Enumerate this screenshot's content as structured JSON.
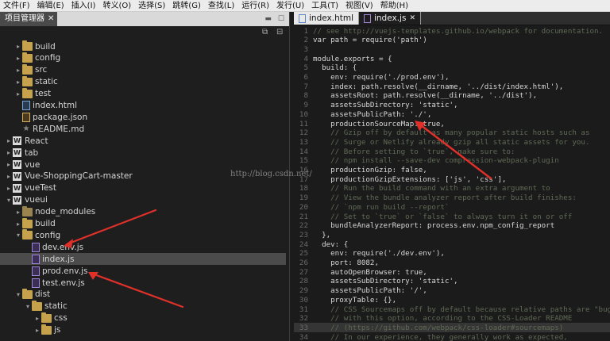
{
  "menu": [
    "文件(F)",
    "编辑(E)",
    "插入(I)",
    "转义(O)",
    "选择(S)",
    "跳转(G)",
    "查找(L)",
    "运行(R)",
    "发行(U)",
    "工具(T)",
    "视图(V)",
    "帮助(H)"
  ],
  "panel": {
    "title": "项目管理器",
    "tree": [
      {
        "label": "build",
        "icon": "folder",
        "depth": 2,
        "arrow": "collapsed"
      },
      {
        "label": "config",
        "icon": "folder",
        "depth": 2,
        "arrow": "collapsed"
      },
      {
        "label": "src",
        "icon": "folder",
        "depth": 2,
        "arrow": "collapsed"
      },
      {
        "label": "static",
        "icon": "folder",
        "depth": 2,
        "arrow": "collapsed"
      },
      {
        "label": "test",
        "icon": "folder",
        "depth": 2,
        "arrow": "collapsed"
      },
      {
        "label": "index.html",
        "icon": "html",
        "depth": 2,
        "arrow": "none"
      },
      {
        "label": "package.json",
        "icon": "json",
        "depth": 2,
        "arrow": "none"
      },
      {
        "label": "README.md",
        "icon": "md",
        "depth": 2,
        "arrow": "none"
      },
      {
        "label": "React",
        "icon": "project",
        "depth": 1,
        "arrow": "collapsed"
      },
      {
        "label": "tab",
        "icon": "project",
        "depth": 1,
        "arrow": "collapsed"
      },
      {
        "label": "vue",
        "icon": "project",
        "depth": 1,
        "arrow": "collapsed"
      },
      {
        "label": "Vue-ShoppingCart-master",
        "icon": "project",
        "depth": 1,
        "arrow": "collapsed"
      },
      {
        "label": "vueTest",
        "icon": "project",
        "depth": 1,
        "arrow": "collapsed"
      },
      {
        "label": "vueui",
        "icon": "project",
        "depth": 1,
        "arrow": "expanded"
      },
      {
        "label": "node_modules",
        "icon": "folder-dark",
        "depth": 2,
        "arrow": "collapsed"
      },
      {
        "label": "build",
        "icon": "folder",
        "depth": 2,
        "arrow": "collapsed"
      },
      {
        "label": "config",
        "icon": "folder",
        "depth": 2,
        "arrow": "expanded"
      },
      {
        "label": "dev.env.js",
        "icon": "js",
        "depth": 3,
        "arrow": "none"
      },
      {
        "label": "index.js",
        "icon": "js",
        "depth": 3,
        "arrow": "none",
        "selected": true
      },
      {
        "label": "prod.env.js",
        "icon": "js",
        "depth": 3,
        "arrow": "none"
      },
      {
        "label": "test.env.js",
        "icon": "js",
        "depth": 3,
        "arrow": "none"
      },
      {
        "label": "dist",
        "icon": "folder",
        "depth": 2,
        "arrow": "expanded"
      },
      {
        "label": "static",
        "icon": "folder",
        "depth": 3,
        "arrow": "expanded"
      },
      {
        "label": "css",
        "icon": "folder",
        "depth": 4,
        "arrow": "collapsed"
      },
      {
        "label": "js",
        "icon": "folder",
        "depth": 4,
        "arrow": "collapsed"
      }
    ]
  },
  "editor": {
    "tabs": [
      {
        "label": "index.html",
        "icon": "html-file-icon",
        "active": false
      },
      {
        "label": "index.js",
        "icon": "js-file-icon",
        "active": true
      }
    ],
    "lines": [
      {
        "n": "1",
        "t": "// see http://vuejs-templates.github.io/webpack for documentation.",
        "k": "comment"
      },
      {
        "n": "2",
        "t": "var path = require('path')",
        "k": "code"
      },
      {
        "n": "3",
        "t": "",
        "k": "code"
      },
      {
        "n": "4",
        "t": "module.exports = {",
        "k": "code"
      },
      {
        "n": "5",
        "t": "  build: {",
        "k": "code"
      },
      {
        "n": "6",
        "t": "    env: require('./prod.env'),",
        "k": "code"
      },
      {
        "n": "7",
        "t": "    index: path.resolve(__dirname, '../dist/index.html'),",
        "k": "code"
      },
      {
        "n": "8",
        "t": "    assetsRoot: path.resolve(__dirname, '../dist'),",
        "k": "code"
      },
      {
        "n": "9",
        "t": "    assetsSubDirectory: 'static',",
        "k": "code"
      },
      {
        "n": "10",
        "t": "    assetsPublicPath: './',",
        "k": "code"
      },
      {
        "n": "11",
        "t": "    productionSourceMap: true,",
        "k": "code"
      },
      {
        "n": "12",
        "t": "    // Gzip off by default as many popular static hosts such as",
        "k": "comment"
      },
      {
        "n": "13",
        "t": "    // Surge or Netlify already gzip all static assets for you.",
        "k": "comment"
      },
      {
        "n": "14",
        "t": "    // Before setting to `true`, make sure to:",
        "k": "comment"
      },
      {
        "n": "15",
        "t": "    // npm install --save-dev compression-webpack-plugin",
        "k": "comment"
      },
      {
        "n": "16",
        "t": "    productionGzip: false,",
        "k": "code"
      },
      {
        "n": "17",
        "t": "    productionGzipExtensions: ['js', 'css'],",
        "k": "code"
      },
      {
        "n": "18",
        "t": "    // Run the build command with an extra argument to",
        "k": "comment"
      },
      {
        "n": "19",
        "t": "    // View the bundle analyzer report after build finishes:",
        "k": "comment"
      },
      {
        "n": "20",
        "t": "    // `npm run build --report`",
        "k": "comment"
      },
      {
        "n": "21",
        "t": "    // Set to `true` or `false` to always turn it on or off",
        "k": "comment"
      },
      {
        "n": "22",
        "t": "    bundleAnalyzerReport: process.env.npm_config_report",
        "k": "code"
      },
      {
        "n": "23",
        "t": "  },",
        "k": "code"
      },
      {
        "n": "24",
        "t": "  dev: {",
        "k": "code"
      },
      {
        "n": "25",
        "t": "    env: require('./dev.env'),",
        "k": "code"
      },
      {
        "n": "26",
        "t": "    port: 8082,",
        "k": "code"
      },
      {
        "n": "27",
        "t": "    autoOpenBrowser: true,",
        "k": "code"
      },
      {
        "n": "28",
        "t": "    assetsSubDirectory: 'static',",
        "k": "code"
      },
      {
        "n": "29",
        "t": "    assetsPublicPath: '/',",
        "k": "code"
      },
      {
        "n": "30",
        "t": "    proxyTable: {},",
        "k": "code"
      },
      {
        "n": "31",
        "t": "    // CSS Sourcemaps off by default because relative paths are \"buggy\"",
        "k": "comment"
      },
      {
        "n": "32",
        "t": "    // with this option, according to the CSS-Loader README",
        "k": "comment"
      },
      {
        "n": "33",
        "t": "    // (https://github.com/webpack/css-loader#sourcemaps)",
        "k": "comment",
        "highlight": true
      },
      {
        "n": "34",
        "t": "    // In our experience, they generally work as expected,",
        "k": "comment"
      }
    ]
  },
  "watermark": "http://blog.csdn.net/"
}
